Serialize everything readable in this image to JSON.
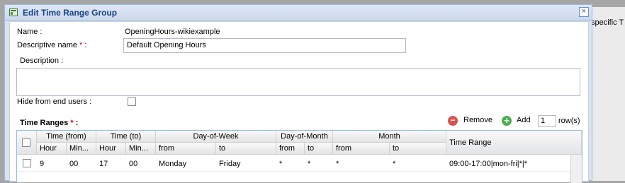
{
  "background": {
    "text": "specific T"
  },
  "dialog": {
    "title": "Edit Time Range Group",
    "close_symbol": "×"
  },
  "form": {
    "name_label": "Name :",
    "name_value": "OpeningHours-wikiexample",
    "descriptive_label": "Descriptive name",
    "required_mark": "*",
    "colon": ":",
    "descriptive_value": "Default Opening Hours",
    "description_label": "Description :",
    "hide_label": "Hide from end users :",
    "time_ranges_label": "Time Ranges",
    "remove_label": "Remove",
    "add_label": "Add",
    "rows_value": "1",
    "rows_suffix": "row(s)"
  },
  "grid": {
    "groups": {
      "time_from": "Time (from)",
      "time_to": "Time (to)",
      "dow": "Day-of-Week",
      "dom": "Day-of-Month",
      "month": "Month",
      "time_range": "Time Range"
    },
    "subheaders": {
      "hour_from": "Hour",
      "min_from": "Min...",
      "hour_to": "Hour",
      "min_to": "Min...",
      "dow_from": "from",
      "dow_to": "to",
      "dom_from": "from",
      "dom_to": "to",
      "month_from": "from",
      "month_to": "to"
    },
    "row": {
      "hour_from": "9",
      "min_from": "00",
      "hour_to": "17",
      "min_to": "00",
      "dow_from": "Monday",
      "dow_to": "Friday",
      "dom_from": "*",
      "dom_to": "*",
      "month_from": "*",
      "month_to": "*",
      "time_range": "09:00-17:00|mon-fri|*|*"
    }
  }
}
